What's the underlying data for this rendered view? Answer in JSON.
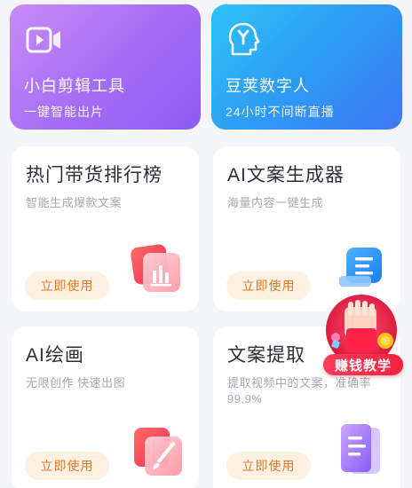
{
  "top_cards": [
    {
      "title": "小白剪辑工具",
      "subtitle": "一键智能出片",
      "icon": "video-camera-icon"
    },
    {
      "title": "豆荚数字人",
      "subtitle": "24小时不间断直播",
      "icon": "digital-human-icon"
    }
  ],
  "features": [
    {
      "title": "热门带货排行榜",
      "desc": "智能生成爆款文案",
      "button": "立即使用",
      "icon": "bar-chart-icon"
    },
    {
      "title": "AI文案生成器",
      "desc": "海量内容一键生成",
      "button": "立即使用",
      "icon": "document-icon"
    },
    {
      "title": "AI绘画",
      "desc": "无限创作 快速出图",
      "button": "立即使用",
      "icon": "paintbrush-icon"
    },
    {
      "title": "文案提取",
      "desc": "提取视频中的文案，准确率99.9%",
      "button": "立即使用",
      "icon": "text-extract-icon"
    }
  ],
  "floating_badge": {
    "label": "赚钱教学",
    "icon": "hand-money-icon"
  },
  "colors": {
    "accent_orange": "#e0792b",
    "badge_red": "#f5223d",
    "purple": "#a46cf5",
    "blue": "#2d9cf4"
  }
}
